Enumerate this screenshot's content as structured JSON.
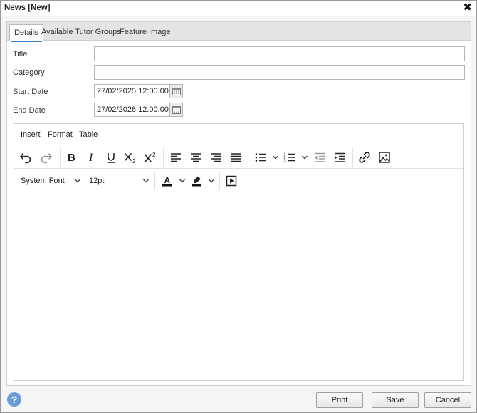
{
  "window": {
    "title": "News [New]",
    "close_glyph": "✖"
  },
  "tabs": [
    {
      "label": "Details",
      "active": true
    },
    {
      "label": "Available Tutor Groups",
      "active": false
    },
    {
      "label": "Feature Image",
      "active": false
    }
  ],
  "form": {
    "title_label": "Title",
    "title_value": "",
    "category_label": "Category",
    "category_value": "",
    "start_date_label": "Start Date",
    "start_date_value": "27/02/2025 12:00:00",
    "end_date_label": "End Date",
    "end_date_value": "27/02/2026 12:00:00"
  },
  "editor": {
    "menus": [
      "Insert",
      "Format",
      "Table"
    ],
    "font_family": "System Font",
    "font_size": "12pt",
    "content": ""
  },
  "footer": {
    "help_glyph": "?",
    "print_label": "Print",
    "save_label": "Save",
    "cancel_label": "Cancel"
  },
  "colors": {
    "accent": "#3e7fd0",
    "help": "#6b9bd6"
  }
}
